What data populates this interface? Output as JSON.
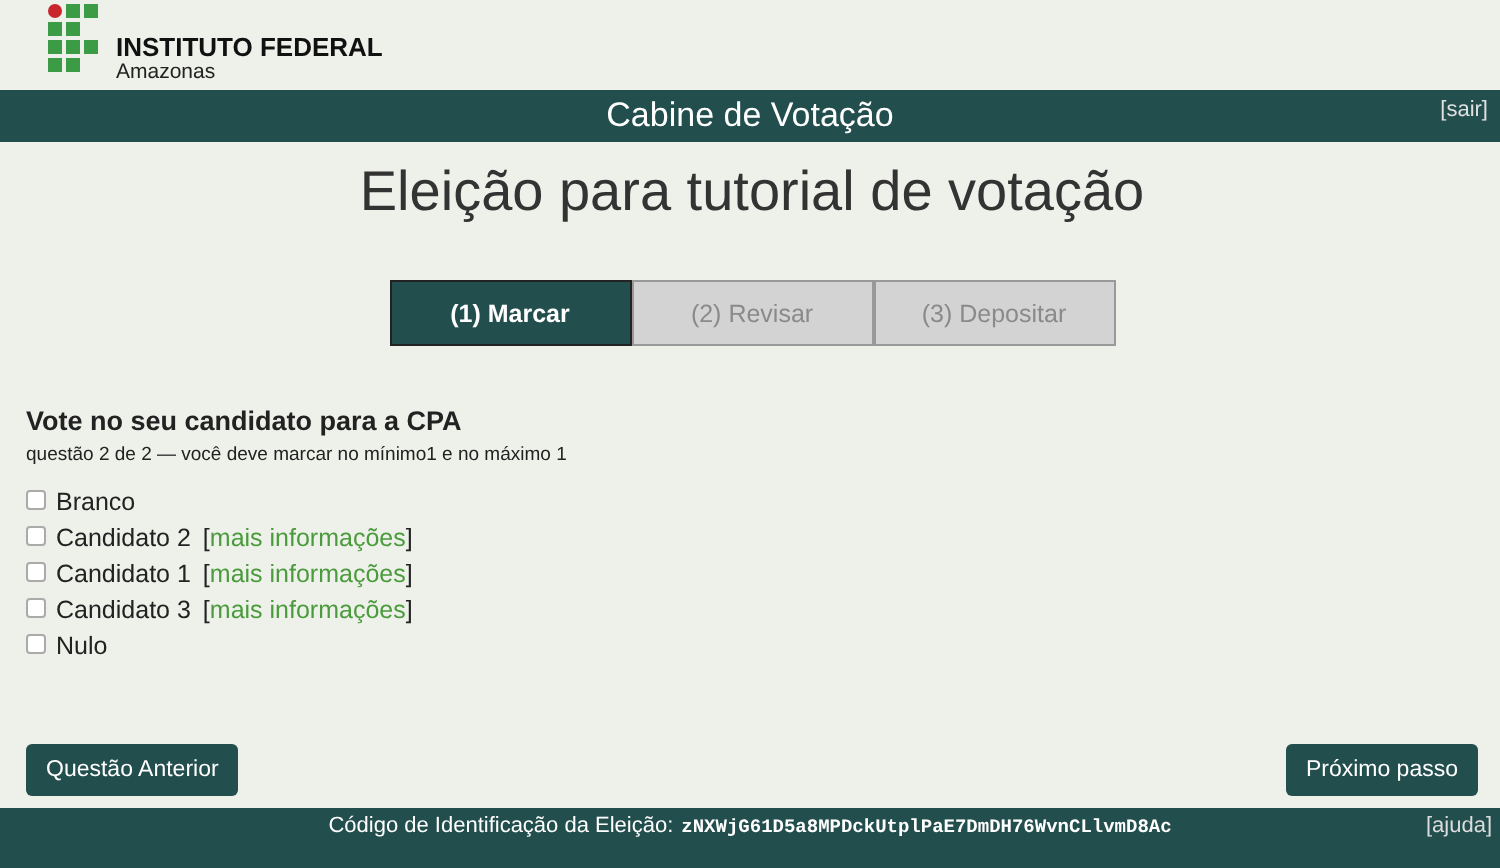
{
  "logo": {
    "name": "INSTITUTO FEDERAL",
    "subtitle": "Amazonas"
  },
  "top_bar": {
    "title": "Cabine de Votação",
    "logout": "[sair]"
  },
  "heading": "Eleição para tutorial de votação",
  "steps": [
    {
      "label": "(1) Marcar",
      "selected": true
    },
    {
      "label": "(2) Revisar",
      "selected": false
    },
    {
      "label": "(3) Depositar",
      "selected": false
    }
  ],
  "question": {
    "title": "Vote no seu candidato para a CPA",
    "hint": "questão 2 de 2 — você deve marcar no mínimo1 e no máximo 1"
  },
  "options": [
    {
      "label": "Branco",
      "checked": false
    },
    {
      "label": "Candidato 2",
      "checked": false,
      "link": {
        "open": "[",
        "label": "mais informações",
        "close": "]"
      }
    },
    {
      "label": "Candidato 1",
      "checked": false,
      "link": {
        "open": "[",
        "label": "mais informações",
        "close": "]"
      }
    },
    {
      "label": "Candidato 3",
      "checked": false,
      "link": {
        "open": "[",
        "label": "mais informações",
        "close": "]"
      }
    },
    {
      "label": "Nulo",
      "checked": false
    }
  ],
  "buttons": {
    "previous": "Questão Anterior",
    "next": "Próximo passo"
  },
  "footer": {
    "label": "Código de Identificação da Eleição:",
    "code": "zNXWjG61D5a8MPDckUtplPaE7DmDH76WvnCLlvmD8Ac",
    "help": "[ajuda]"
  }
}
